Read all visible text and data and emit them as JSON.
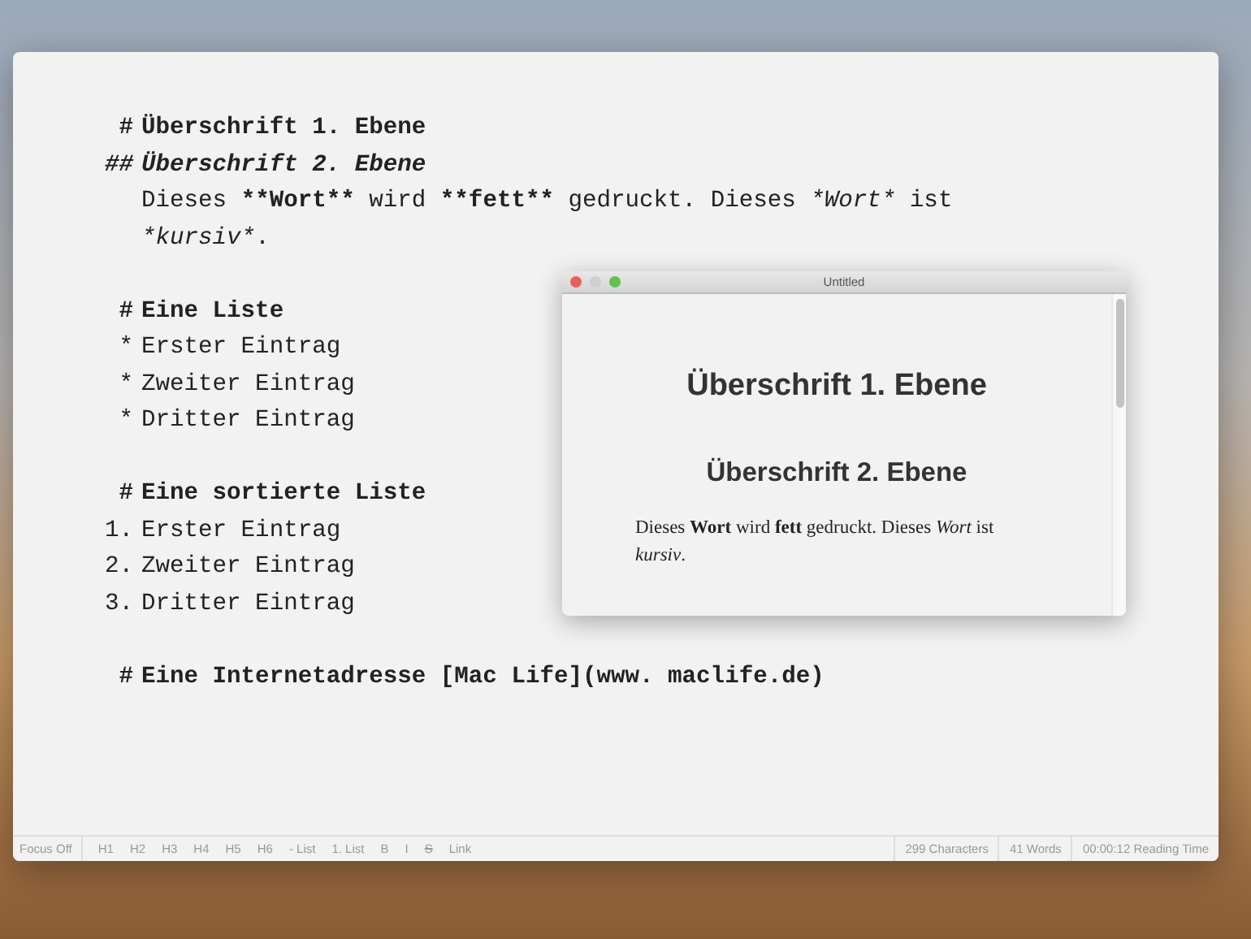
{
  "editor": {
    "blocks": [
      {
        "lines": [
          {
            "kind": "h1",
            "marker": "#",
            "segments": [
              {
                "kind": "bold",
                "text": "Überschrift 1. Ebene"
              }
            ]
          },
          {
            "kind": "h2",
            "marker": "##",
            "segments": [
              {
                "kind": "bolditalic",
                "text": "Überschrift 2. Ebene"
              }
            ]
          },
          {
            "kind": "para",
            "segments": [
              {
                "kind": "plain",
                "text": "Dieses "
              },
              {
                "kind": "bold",
                "text": "**Wort**"
              },
              {
                "kind": "plain",
                "text": " wird "
              },
              {
                "kind": "bold",
                "text": "**fett**"
              },
              {
                "kind": "plain",
                "text": " gedruckt. Dieses "
              },
              {
                "kind": "italic",
                "text": "*Wort*"
              },
              {
                "kind": "plain",
                "text": " ist "
              },
              {
                "kind": "italic",
                "text": "*kursiv*"
              },
              {
                "kind": "plain",
                "text": "."
              }
            ]
          }
        ]
      },
      {
        "lines": [
          {
            "kind": "h1",
            "marker": "#",
            "segments": [
              {
                "kind": "bold",
                "text": "Eine Liste"
              }
            ]
          },
          {
            "kind": "item",
            "marker": "*",
            "segments": [
              {
                "kind": "plain",
                "text": "Erster Eintrag"
              }
            ]
          },
          {
            "kind": "item",
            "marker": "*",
            "segments": [
              {
                "kind": "plain",
                "text": "Zweiter Eintrag"
              }
            ]
          },
          {
            "kind": "item",
            "marker": "*",
            "segments": [
              {
                "kind": "plain",
                "text": "Dritter Eintrag"
              }
            ]
          }
        ]
      },
      {
        "lines": [
          {
            "kind": "h1",
            "marker": "#",
            "segments": [
              {
                "kind": "bold",
                "text": "Eine sortierte Liste"
              }
            ]
          },
          {
            "kind": "item",
            "marker": "1.",
            "segments": [
              {
                "kind": "plain",
                "text": "Erster Eintrag"
              }
            ]
          },
          {
            "kind": "item",
            "marker": "2.",
            "segments": [
              {
                "kind": "plain",
                "text": "Zweiter Eintrag"
              }
            ]
          },
          {
            "kind": "item",
            "marker": "3.",
            "segments": [
              {
                "kind": "plain",
                "text": "Dritter Eintrag"
              }
            ]
          }
        ]
      },
      {
        "lines": [
          {
            "kind": "h1",
            "marker": "#",
            "segments": [
              {
                "kind": "bold",
                "text": "Eine Internetadresse [Mac Life](www. maclife.de)"
              }
            ]
          }
        ]
      }
    ]
  },
  "preview": {
    "title": "Untitled",
    "window_buttons": [
      {
        "color": "#ec5f57"
      },
      {
        "color": "#d0d0d0"
      },
      {
        "color": "#5fc24d"
      }
    ],
    "heading_1": "Überschrift 1. Ebene",
    "heading_2": "Überschrift 2. Ebene",
    "paragraph": "Dieses **Wort** wird **fett** gedruckt. Dieses *Wort* ist *kursiv*."
  },
  "status_bar": {
    "focus": "Focus Off",
    "format_buttons": [
      {
        "label": "H1",
        "kind": "plain"
      },
      {
        "label": "H2",
        "kind": "plain"
      },
      {
        "label": "H3",
        "kind": "plain"
      },
      {
        "label": "H4",
        "kind": "plain"
      },
      {
        "label": "H5",
        "kind": "plain"
      },
      {
        "label": "H6",
        "kind": "plain"
      },
      {
        "label": "- List",
        "kind": "plain"
      },
      {
        "label": "1. List",
        "kind": "plain"
      },
      {
        "label": "B",
        "kind": "bold"
      },
      {
        "label": "I",
        "kind": "italic"
      },
      {
        "label": "S",
        "kind": "strike"
      },
      {
        "label": "Link",
        "kind": "plain"
      }
    ],
    "stats": [
      "299 Characters",
      "41 Words",
      "00:00:12 Reading Time"
    ]
  }
}
